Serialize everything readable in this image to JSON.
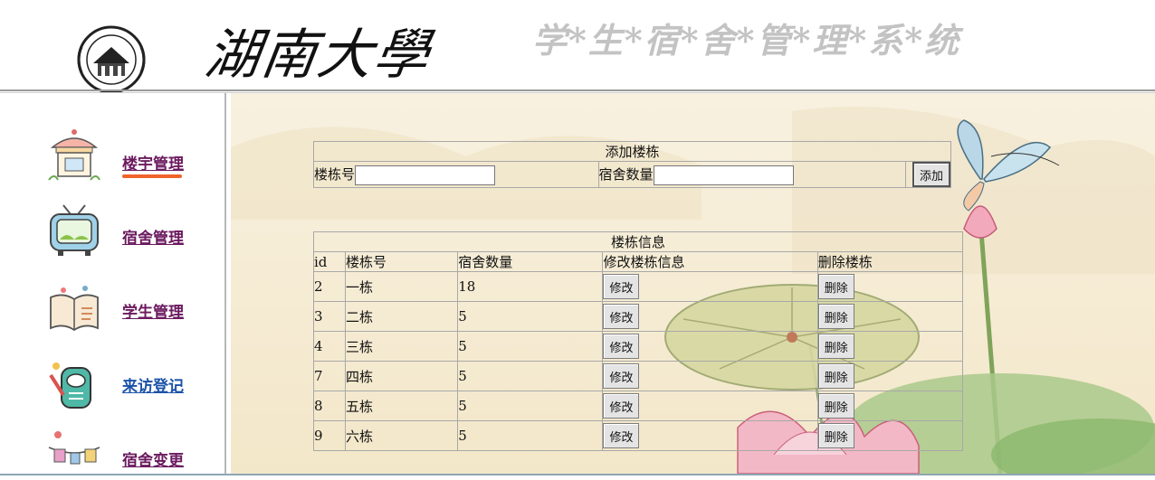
{
  "header": {
    "university_name": "湖南大學",
    "system_title": "学*生*宿*舍*管*理*系*统"
  },
  "sidebar": {
    "items": [
      {
        "label": "楼宇管理",
        "icon": "pavilion-icon",
        "active": true
      },
      {
        "label": "宿舍管理",
        "icon": "tv-icon",
        "active": false
      },
      {
        "label": "学生管理",
        "icon": "book-icon",
        "active": false
      },
      {
        "label": "来访登记",
        "icon": "phone-icon",
        "active": false
      },
      {
        "label": "宿舍变更",
        "icon": "clothesline-icon",
        "active": false
      }
    ]
  },
  "add_form": {
    "title": "添加楼栋",
    "building_label": "楼栋号",
    "building_value": "",
    "rooms_label": "宿舍数量",
    "rooms_value": "",
    "add_button": "添加"
  },
  "info_table": {
    "title": "楼栋信息",
    "columns": [
      "id",
      "楼栋号",
      "宿舍数量",
      "修改楼栋信息",
      "删除楼栋"
    ],
    "rows": [
      {
        "id": "2",
        "building": "一栋",
        "rooms": "18"
      },
      {
        "id": "3",
        "building": "二栋",
        "rooms": "5"
      },
      {
        "id": "4",
        "building": "三栋",
        "rooms": "5"
      },
      {
        "id": "7",
        "building": "四栋",
        "rooms": "5"
      },
      {
        "id": "8",
        "building": "五栋",
        "rooms": "5"
      },
      {
        "id": "9",
        "building": "六栋",
        "rooms": "5"
      }
    ],
    "edit_button": "修改",
    "delete_button": "删除"
  },
  "colors": {
    "nav_link": "#6b1a5f",
    "nav_link_visited": "#1b52a8",
    "active_underline": "#f0632b",
    "main_bg": "#f6edd7"
  }
}
